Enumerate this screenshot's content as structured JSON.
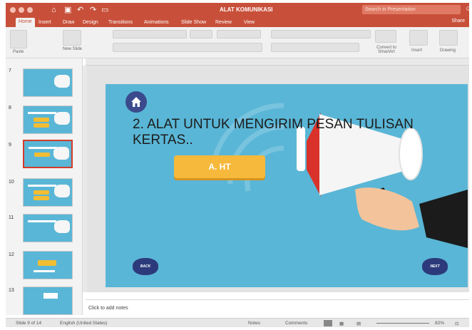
{
  "window": {
    "title": "ALAT KOMUNIKASI",
    "search_placeholder": "Search in Presentation",
    "share_label": "Share"
  },
  "tabs": [
    "Home",
    "Insert",
    "Draw",
    "Design",
    "Transitions",
    "Animations",
    "Slide Show",
    "Review",
    "View"
  ],
  "ribbon": {
    "paste": "Paste",
    "new_slide": "New Slide",
    "convert": "Convert to SmartArt",
    "insert": "Insert",
    "drawing": "Drawing"
  },
  "thumbnails": [
    "7",
    "8",
    "9",
    "10",
    "11",
    "12",
    "13"
  ],
  "slide": {
    "heading": "2. ALAT UNTUK MENGIRIM PESAN TULISAN KERTAS..",
    "answer_button": "A. HT",
    "back_button": "BACK",
    "next_button": "NEXT"
  },
  "notes": {
    "placeholder": "Click to add notes"
  },
  "status": {
    "slide_info": "Slide 9 of 14",
    "language": "English (United States)",
    "notes": "Notes",
    "comments": "Comments",
    "zoom": "82%"
  },
  "colors": {
    "accent": "#c8503a",
    "slide_bg": "#5ab6d6",
    "button": "#f6b93b",
    "nav": "#2c3a7c"
  }
}
